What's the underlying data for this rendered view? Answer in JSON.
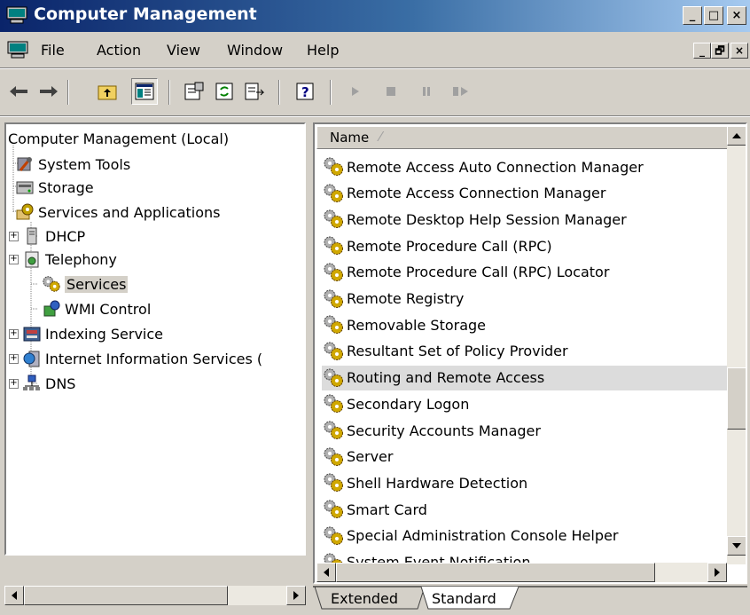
{
  "window": {
    "title": "Computer Management"
  },
  "title_buttons": {
    "minimize": "_",
    "maximize": "□",
    "close": "×"
  },
  "menu": [
    {
      "label": "File"
    },
    {
      "label": "Action"
    },
    {
      "label": "View"
    },
    {
      "label": "Window"
    },
    {
      "label": "Help"
    }
  ],
  "mdi_buttons": {
    "minimize": "_",
    "restore": "🗗",
    "close": "×"
  },
  "toolbar": {
    "icons": [
      "back-icon",
      "forward-icon",
      "up-folder-icon",
      "show-hide-tree-icon",
      "properties-icon",
      "refresh-icon",
      "export-list-icon",
      "help-icon",
      "start-service-icon",
      "stop-service-icon",
      "pause-service-icon",
      "restart-service-icon"
    ]
  },
  "tree": {
    "root": "Computer Management (Local)",
    "items": [
      {
        "label": "System Tools",
        "icon": "system-tools-icon"
      },
      {
        "label": "Storage",
        "icon": "storage-icon"
      },
      {
        "label": "Services and Applications",
        "icon": "services-apps-icon"
      },
      {
        "label": "DHCP",
        "icon": "dhcp-icon"
      },
      {
        "label": "Telephony",
        "icon": "telephony-icon"
      },
      {
        "label": "Services",
        "icon": "services-icon",
        "selected": true
      },
      {
        "label": "WMI Control",
        "icon": "wmi-icon"
      },
      {
        "label": "Indexing Service",
        "icon": "indexing-icon"
      },
      {
        "label": "Internet Information Services (",
        "icon": "iis-icon"
      },
      {
        "label": "DNS",
        "icon": "dns-icon"
      }
    ]
  },
  "list": {
    "column_header": "Name",
    "sort_indicator": "⁄",
    "rows": [
      "Remote Access Auto Connection Manager",
      "Remote Access Connection Manager",
      "Remote Desktop Help Session Manager",
      "Remote Procedure Call (RPC)",
      "Remote Procedure Call (RPC) Locator",
      "Remote Registry",
      "Removable Storage",
      "Resultant Set of Policy Provider",
      "Routing and Remote Access",
      "Secondary Logon",
      "Security Accounts Manager",
      "Server",
      "Shell Hardware Detection",
      "Smart Card",
      "Special Administration Console Helper",
      "System Event Notification"
    ],
    "highlighted": "Routing and Remote Access"
  },
  "tabs": [
    {
      "label": "Extended"
    },
    {
      "label": "Standard",
      "active": true
    }
  ],
  "colors": {
    "titlebar": "#0a246a",
    "face": "#d4d0c8",
    "highlight_row": "#dcdcdc"
  }
}
